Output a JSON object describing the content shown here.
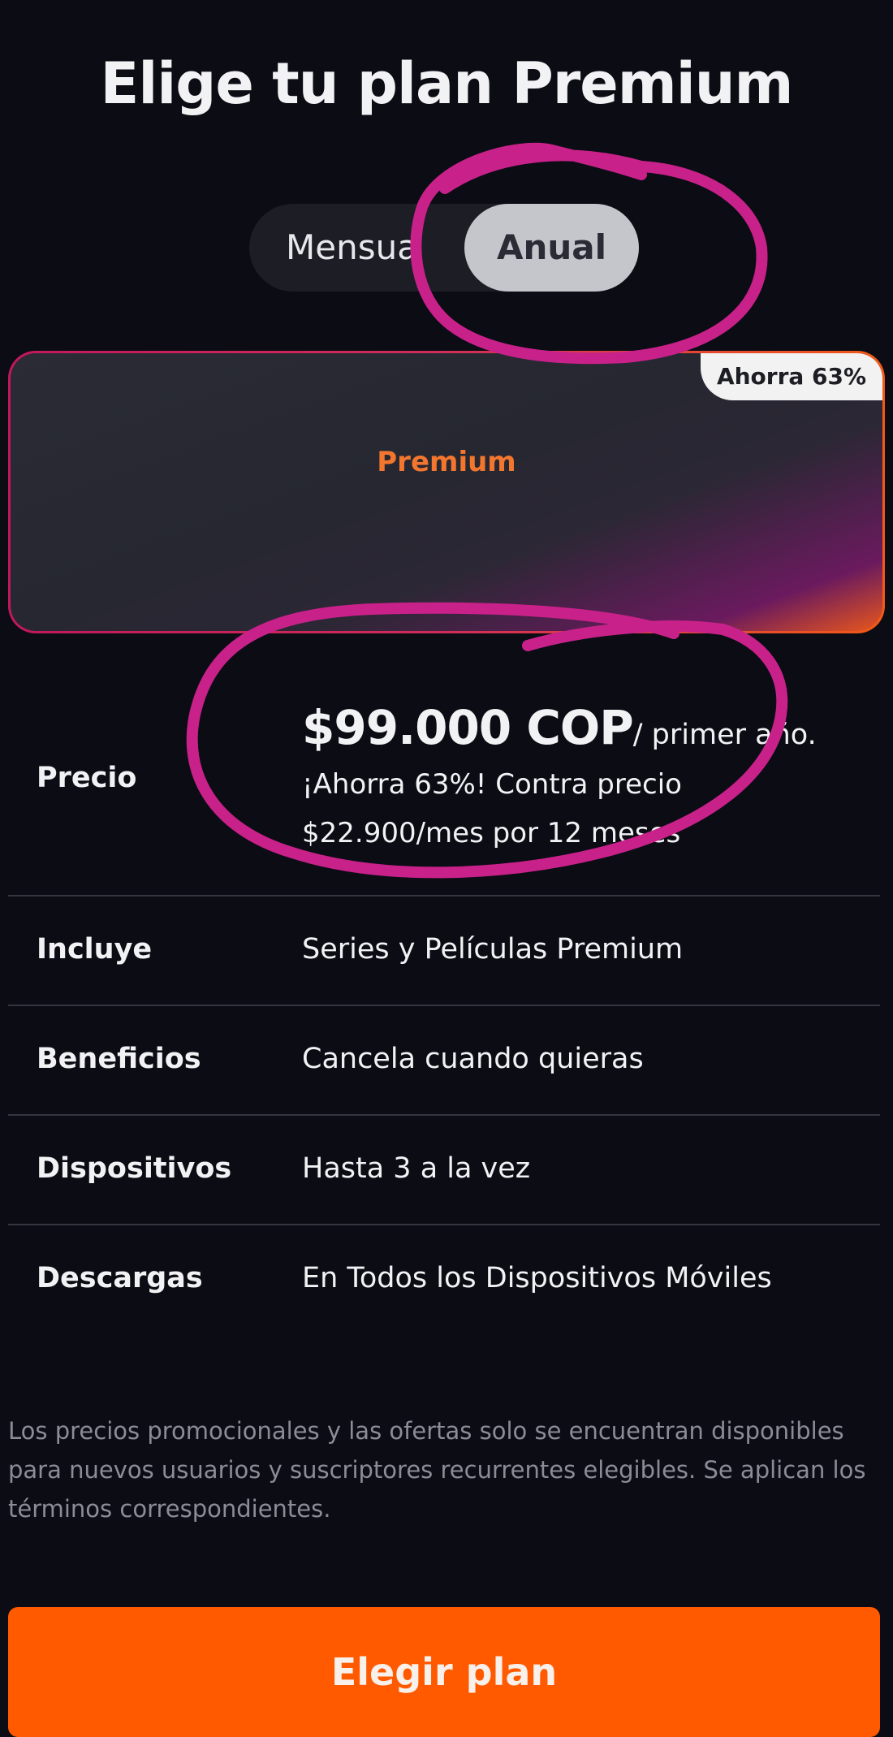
{
  "header": {
    "title": "Elige tu plan Premium"
  },
  "billing_toggle": {
    "options": [
      {
        "label": "Mensual",
        "selected": false
      },
      {
        "label": "Anual",
        "selected": true
      }
    ]
  },
  "plan_card": {
    "badge": "Ahorra 63%",
    "name": "Premium"
  },
  "details": {
    "price": {
      "label": "Precio",
      "amount": "$99.000 COP",
      "period": "/ primer año.",
      "note_line1": "¡Ahorra 63%! Contra precio",
      "note_line2": "$22.900/mes por 12 meses"
    },
    "rows": [
      {
        "label": "Incluye",
        "value": "Series y Películas Premium"
      },
      {
        "label": "Beneficios",
        "value": "Cancela cuando quieras"
      },
      {
        "label": "Dispositivos",
        "value": "Hasta 3 a la vez"
      },
      {
        "label": "Descargas",
        "value": "En Todos los Dispositivos Móviles"
      }
    ]
  },
  "disclaimer": "Los precios promocionales y las ofertas solo se encuentran disponibles para nuevos usuarios y suscriptores recurrentes elegibles. Se aplican los términos correspondientes.",
  "cta": {
    "label": "Elegir plan"
  },
  "colors": {
    "accent": "#ff5a00",
    "annotation": "#c8218a",
    "background": "#0b0c14"
  }
}
